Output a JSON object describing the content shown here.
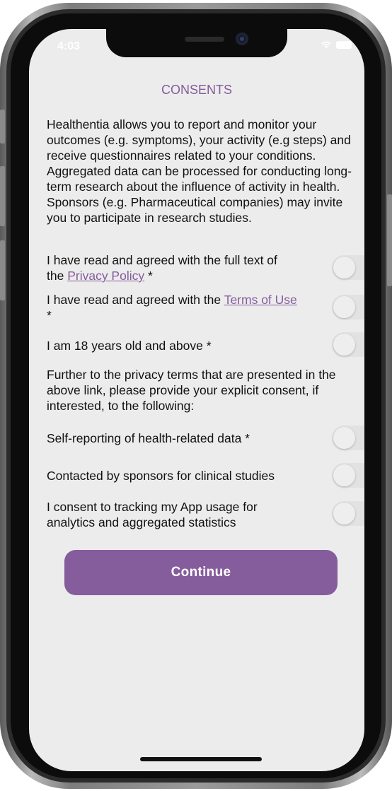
{
  "status_bar": {
    "time": "4:03"
  },
  "screen": {
    "title": "CONSENTS",
    "intro": "Healthentia allows you to report and monitor your outcomes (e.g. symptoms), your activity (e.g steps) and receive questionnaires related to your conditions. Aggregated data can be processed for conducting long-term research about the influence of activity in health. Sponsors (e.g. Pharmaceutical companies) may invite you to participate in research studies.",
    "consents": [
      {
        "pre": "I have read and agreed with the full text of the ",
        "link": "Privacy Policy",
        "post": " *",
        "checked": false
      },
      {
        "pre": "I have read and agreed with the ",
        "link": "Terms of Use",
        "post": " *",
        "checked": false
      },
      {
        "pre": "I am 18 years old and above *",
        "link": "",
        "post": "",
        "checked": false
      }
    ],
    "further_text": "Further to the privacy terms that are presented in the above link, please provide your explicit consent, if interested, to the following:",
    "optional_consents": [
      {
        "label": "Self-reporting of health-related data *",
        "checked": false
      },
      {
        "label": "Contacted by sponsors for clinical studies",
        "checked": false
      },
      {
        "label": "I consent to tracking my App usage for analytics and aggregated statistics",
        "checked": false
      }
    ],
    "continue_label": "Continue"
  },
  "colors": {
    "accent": "#855c9c",
    "background": "#ececec",
    "toggle_off": "#e2e2e2"
  },
  "icons": {
    "wifi": "wifi-icon",
    "battery": "battery-icon"
  }
}
